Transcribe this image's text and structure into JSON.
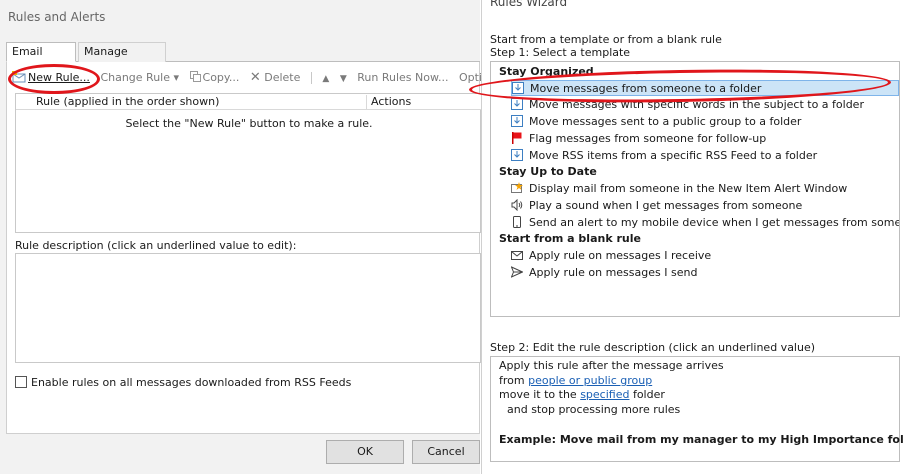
{
  "left_dialog": {
    "title": "Rules and Alerts",
    "tabs": [
      {
        "label": "Email Rules",
        "active": true
      },
      {
        "label": "Manage Alerts",
        "active": false
      }
    ],
    "toolbar": {
      "new_rule": "New Rule...",
      "change_rule": "Change Rule ▾",
      "copy": "Copy...",
      "delete": "Delete",
      "move_up": "▲",
      "move_down": "▼",
      "run_rules": "Run Rules Now...",
      "options": "Opti"
    },
    "table": {
      "col_rule": "Rule (applied in the order shown)",
      "col_actions": "Actions",
      "empty_message": "Select the \"New Rule\" button to make a rule."
    },
    "description_label": "Rule description (click an underlined value to edit):",
    "rss_checkbox_label": "Enable rules on all messages downloaded from RSS Feeds",
    "rss_checked": false,
    "ok": "OK",
    "cancel": "Cancel"
  },
  "wizard": {
    "title": "Rules Wizard",
    "start_label": "Start from a template or from a blank rule",
    "step1_label": "Step 1: Select a template",
    "groups": [
      {
        "label": "Stay Organized",
        "items": [
          {
            "label": "Move messages from someone to a folder",
            "icon": "move-folder-icon",
            "selected": true
          },
          {
            "label": "Move messages with specific words in the subject to a folder",
            "icon": "move-folder-icon",
            "selected": false
          },
          {
            "label": "Move messages sent to a public group to a folder",
            "icon": "move-folder-icon",
            "selected": false
          },
          {
            "label": "Flag messages from someone for follow-up",
            "icon": "flag-icon",
            "selected": false
          },
          {
            "label": "Move RSS items from a specific RSS Feed to a folder",
            "icon": "move-folder-icon",
            "selected": false
          }
        ]
      },
      {
        "label": "Stay Up to Date",
        "items": [
          {
            "label": "Display mail from someone in the New Item Alert Window",
            "icon": "alert-star-icon",
            "selected": false
          },
          {
            "label": "Play a sound when I get messages from someone",
            "icon": "speaker-icon",
            "selected": false
          },
          {
            "label": "Send an alert to my mobile device when I get messages from someone",
            "icon": "mobile-device-icon",
            "selected": false
          }
        ]
      },
      {
        "label": "Start from a blank rule",
        "items": [
          {
            "label": "Apply rule on messages I receive",
            "icon": "envelope-icon",
            "selected": false
          },
          {
            "label": "Apply rule on messages I send",
            "icon": "send-arrow-icon",
            "selected": false
          }
        ]
      }
    ],
    "step2_label": "Step 2: Edit the rule description (click an underlined value)",
    "desc": {
      "line1": "Apply this rule after the message arrives",
      "line2_prefix": "from ",
      "line2_link": "people or public group",
      "line3_prefix": "move it to the ",
      "line3_link": "specified",
      "line3_suffix": " folder",
      "line4": "and stop processing more rules"
    },
    "example": "Example: Move mail from my manager to my High Importance folder"
  },
  "colors": {
    "highlight_oval": "#e0161b",
    "selection_bg": "#cce4f7",
    "link": "#1a5fb4"
  }
}
